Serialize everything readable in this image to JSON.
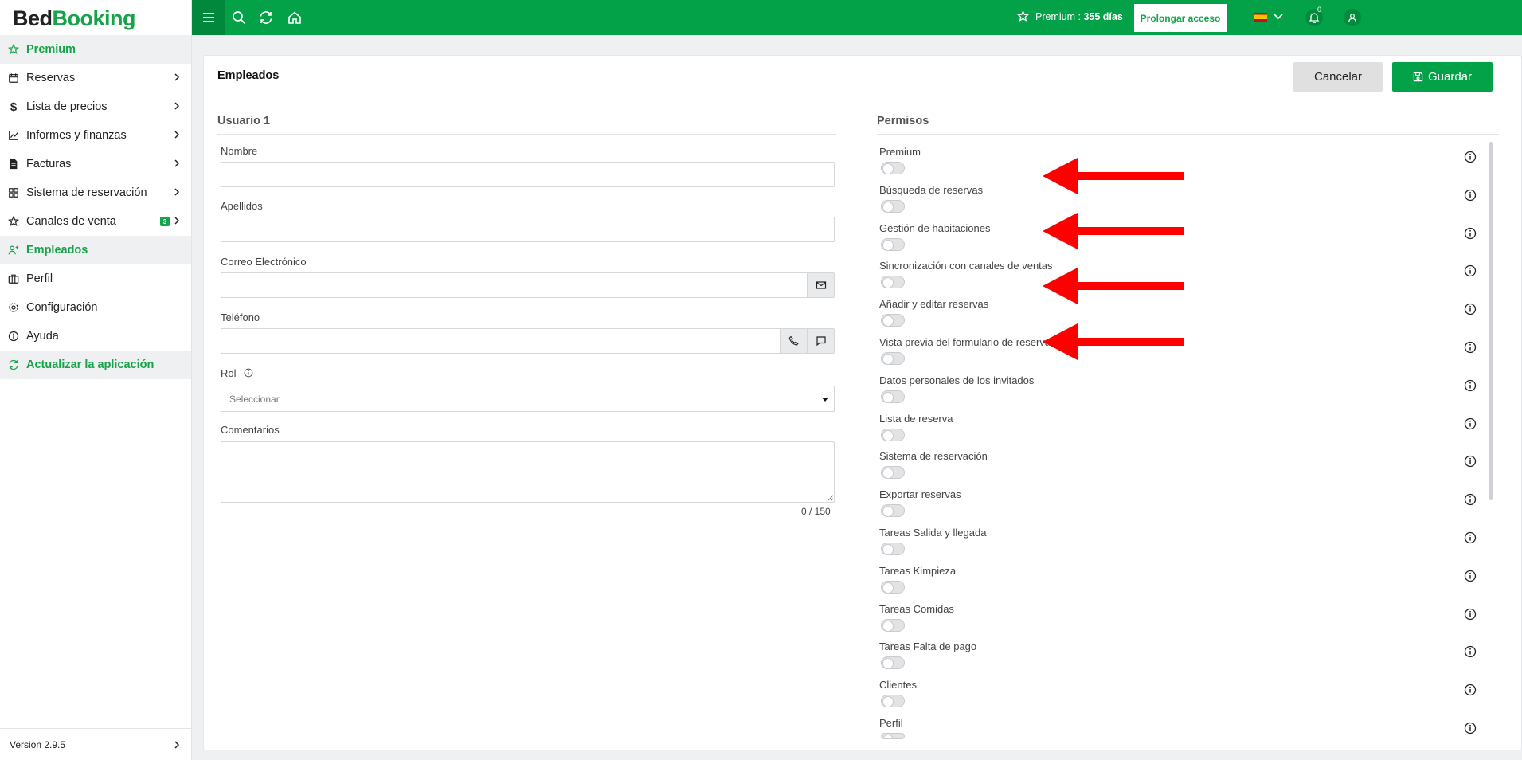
{
  "app": {
    "logo_part1": "Bed",
    "logo_part2": "Booking",
    "version": "Version 2.9.5"
  },
  "sidebar": {
    "items": [
      {
        "label": "Premium",
        "icon": "star-icon"
      },
      {
        "label": "Reservas",
        "icon": "calendar-icon"
      },
      {
        "label": "Lista de precios",
        "icon": "dollar-icon"
      },
      {
        "label": "Informes y finanzas",
        "icon": "chart-icon"
      },
      {
        "label": "Facturas",
        "icon": "invoice-icon"
      },
      {
        "label": "Sistema de reservación",
        "icon": "grid-icon"
      },
      {
        "label": "Canales de venta",
        "icon": "star-icon",
        "badge": "3"
      },
      {
        "label": "Empleados",
        "icon": "users-icon"
      },
      {
        "label": "Perfil",
        "icon": "briefcase-icon"
      },
      {
        "label": "Configuración",
        "icon": "gear-icon"
      },
      {
        "label": "Ayuda",
        "icon": "info-icon"
      },
      {
        "label": "Actualizar la aplicación",
        "icon": "refresh-icon"
      }
    ]
  },
  "topbar": {
    "premium_label": "Premium :",
    "premium_days": "355 días",
    "extend_button": "Prolongar acceso",
    "notification_count": "0"
  },
  "page": {
    "title": "Empleados",
    "cancel_button": "Cancelar",
    "save_button": "Guardar"
  },
  "user_form": {
    "section_title": "Usuario 1",
    "name_label": "Nombre",
    "lastname_label": "Apellidos",
    "email_label": "Correo Electrónico",
    "phone_label": "Teléfono",
    "role_label": "Rol",
    "role_placeholder": "Seleccionar",
    "comments_label": "Comentarios",
    "comments_counter": "0 / 150"
  },
  "permissions": {
    "section_title": "Permisos",
    "items": [
      "Premium",
      "Búsqueda de reservas",
      "Gestión de habitaciones",
      "Sincronización con canales de ventas",
      "Añadir y editar reservas",
      "Vista previa del formulario de reserva",
      "Datos personales de los invitados",
      "Lista de reserva",
      "Sistema de reservación",
      "Exportar reservas",
      "Tareas Salida y llegada",
      "Tareas Kimpieza",
      "Tareas Comidas",
      "Tareas Falta de pago",
      "Clientes",
      "Perfil"
    ]
  },
  "colors": {
    "brand_green": "#03a148",
    "arrow_red": "#ff0000"
  }
}
